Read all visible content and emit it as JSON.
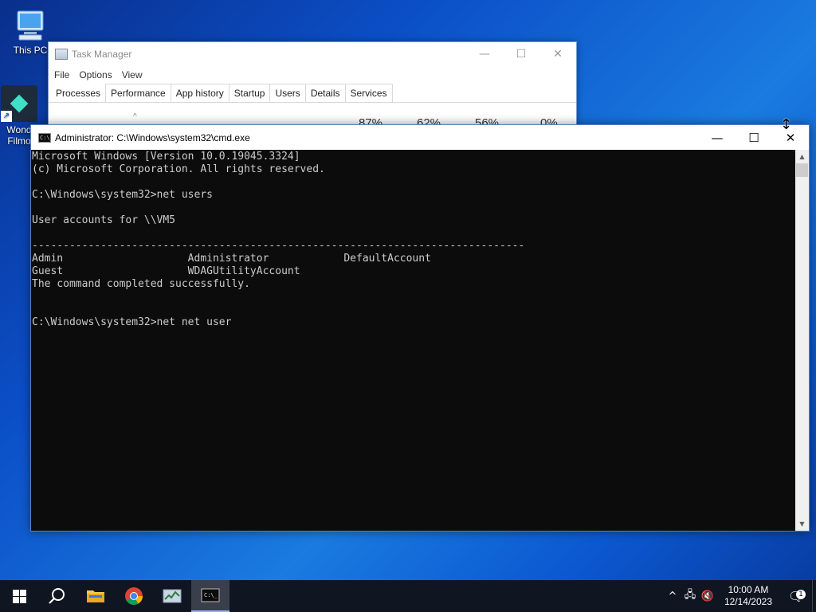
{
  "desktop": {
    "icons": [
      {
        "label": "This PC"
      },
      {
        "label": "Wond\nFilmo"
      }
    ]
  },
  "task_manager": {
    "title": "Task Manager",
    "menu": [
      "File",
      "Options",
      "View"
    ],
    "tabs": [
      "Processes",
      "Performance",
      "App history",
      "Startup",
      "Users",
      "Details",
      "Services"
    ],
    "active_tab": "Processes",
    "metrics": [
      "87%",
      "62%",
      "56%",
      "0%"
    ],
    "controls": {
      "minimize": "—",
      "maximize": "☐",
      "close": "✕"
    }
  },
  "cmd": {
    "title": "Administrator: C:\\Windows\\system32\\cmd.exe",
    "icon_text": "C:\\_",
    "controls": {
      "minimize": "—",
      "maximize": "☐",
      "close": "✕"
    },
    "lines": [
      "Microsoft Windows [Version 10.0.19045.3324]",
      "(c) Microsoft Corporation. All rights reserved.",
      "",
      "C:\\Windows\\system32>net users",
      "",
      "User accounts for \\\\VM5",
      "",
      "-------------------------------------------------------------------------------",
      "Admin                    Administrator            DefaultAccount",
      "Guest                    WDAGUtilityAccount",
      "The command completed successfully.",
      "",
      "",
      "C:\\Windows\\system32>net net user"
    ]
  },
  "taskbar": {
    "pinned": [
      {
        "name": "start-button",
        "icon": "windows-logo"
      },
      {
        "name": "search-button",
        "icon": "search-icon"
      },
      {
        "name": "file-explorer-button",
        "icon": "folder-icon"
      },
      {
        "name": "chrome-button",
        "icon": "chrome-icon"
      },
      {
        "name": "task-manager-button",
        "icon": "task-manager-icon"
      },
      {
        "name": "cmd-button",
        "icon": "cmd-icon",
        "active": true
      }
    ],
    "tray": {
      "chevron": "^",
      "time": "10:00 AM",
      "date": "12/14/2023",
      "notification_count": "1"
    }
  },
  "colors": {
    "console_bg": "#0c0c0c",
    "console_fg": "#cccccc",
    "taskbar_bg": "#101522"
  }
}
